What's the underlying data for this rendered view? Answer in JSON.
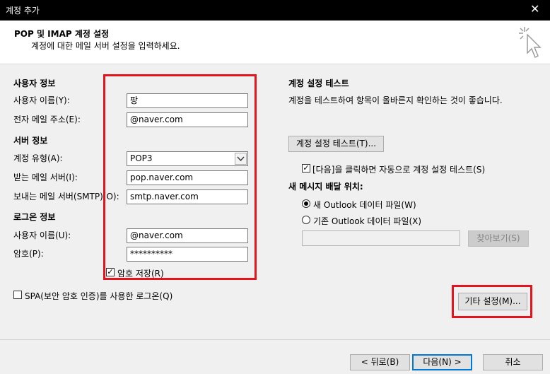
{
  "window": {
    "title": "계정 추가",
    "close_icon": "✕"
  },
  "header": {
    "title": "POP 및 IMAP 계정 설정",
    "subtitle": "계정에 대한 메일 서버 설정을 입력하세요."
  },
  "user_info": {
    "section": "사용자 정보",
    "name_label": "사용자 이름(Y):",
    "name_value": "팡",
    "email_label": "전자 메일 주소(E):",
    "email_value": "@naver.com"
  },
  "server_info": {
    "section": "서버 정보",
    "type_label": "계정 유형(A):",
    "type_value": "POP3",
    "incoming_label": "받는 메일 서버(I):",
    "incoming_value": "pop.naver.com",
    "outgoing_label": "보내는 메일 서버(SMTP)(O):",
    "outgoing_value": "smtp.naver.com"
  },
  "logon_info": {
    "section": "로그온 정보",
    "user_label": "사용자 이름(U):",
    "user_value": "@naver.com",
    "password_label": "암호(P):",
    "password_value": "**********",
    "remember_label": "암호 저장(R)",
    "remember_checked": true
  },
  "spa": {
    "label": "SPA(보안 암호 인증)를 사용한 로그온(Q)",
    "checked": false
  },
  "test": {
    "section": "계정 설정 테스트",
    "description": "계정을 테스트하여 항목이 올바른지 확인하는 것이 좋습니다.",
    "button": "계정 설정 테스트(T)...",
    "auto_label": "[다음]을 클릭하면 자동으로 계정 설정 테스트(S)",
    "auto_checked": true
  },
  "delivery": {
    "section": "새 메시지 배달 위치:",
    "new_file": "새 Outlook 데이터 파일(W)",
    "existing_file": "기존 Outlook 데이터 파일(X)",
    "path_value": "",
    "browse_button": "찾아보기(S)"
  },
  "more_settings_button": "기타 설정(M)...",
  "footer": {
    "back": "< 뒤로(B)",
    "next": "다음(N) >",
    "cancel": "취소"
  },
  "colors": {
    "highlight": "#e3141b",
    "focus": "#0078d7"
  }
}
